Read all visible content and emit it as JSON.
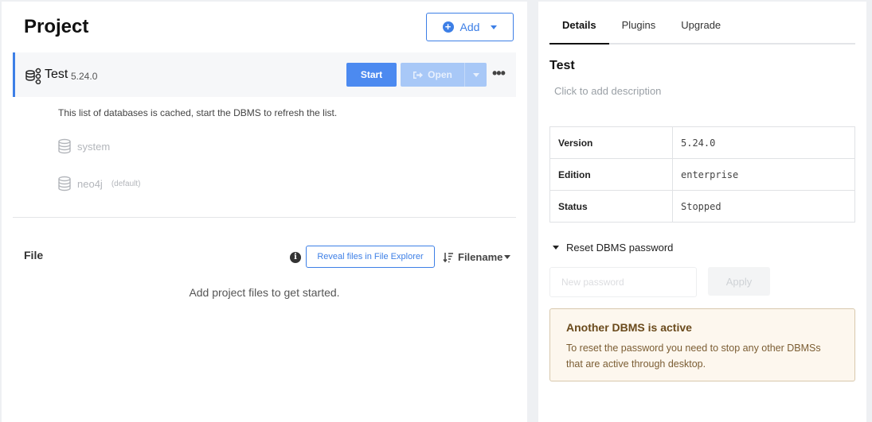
{
  "project": {
    "title": "Project",
    "add_label": "Add"
  },
  "dbms": {
    "name": "Test",
    "version": "5.24.0",
    "start_label": "Start",
    "open_label": "Open",
    "cache_note": "This list of databases is cached, start the DBMS to refresh the list.",
    "databases": [
      {
        "name": "system",
        "tag": ""
      },
      {
        "name": "neo4j",
        "tag": "(default)"
      }
    ]
  },
  "files": {
    "title": "File",
    "reveal_label": "Reveal files in File Explorer",
    "sort_label": "Filename",
    "empty_text": "Add project files to get started."
  },
  "details": {
    "tabs": [
      "Details",
      "Plugins",
      "Upgrade"
    ],
    "active_tab": "Details",
    "title": "Test",
    "description_placeholder": "Click to add description",
    "rows": [
      {
        "key": "Version",
        "value": "5.24.0"
      },
      {
        "key": "Edition",
        "value": "enterprise"
      },
      {
        "key": "Status",
        "value": "Stopped"
      }
    ],
    "reset_label": "Reset DBMS password",
    "password_placeholder": "New password",
    "apply_label": "Apply",
    "warning_title": "Another DBMS is active",
    "warning_text": "To reset the password you need to stop any other DBMSs that are active through desktop."
  },
  "colors": {
    "accent": "#3d7fe6",
    "warning_bg": "#fdf7ee",
    "warning_border": "#d8c8ad"
  }
}
